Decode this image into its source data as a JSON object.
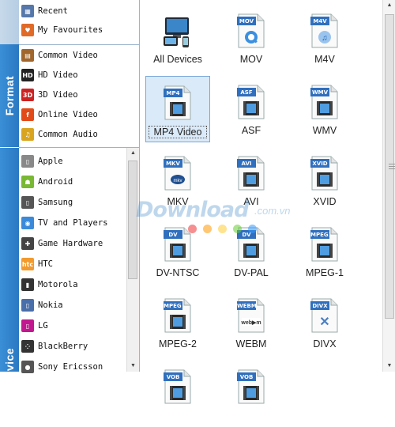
{
  "tabs": {
    "format_label": "Format",
    "device_label": "Device"
  },
  "top_list": [
    {
      "label": "Recent",
      "icon": "grid-icon",
      "color": "#5577aa"
    },
    {
      "label": "My Favourites",
      "icon": "heart-icon",
      "color": "#e06a28"
    }
  ],
  "format_list": [
    {
      "label": "Common Video",
      "icon": "film-icon",
      "color": "#a0662b"
    },
    {
      "label": "HD Video",
      "icon": "hd-icon",
      "color": "#222222"
    },
    {
      "label": "3D Video",
      "icon": "3d-icon",
      "color": "#cc2222"
    },
    {
      "label": "Online Video",
      "icon": "online-video-icon",
      "color": "#e24a1a"
    },
    {
      "label": "Common Audio",
      "icon": "music-note-icon",
      "color": "#d9a520"
    }
  ],
  "device_list": [
    {
      "label": "Apple",
      "icon": "ipod-icon",
      "color": "#888888"
    },
    {
      "label": "Android",
      "icon": "android-icon",
      "color": "#78b833"
    },
    {
      "label": "Samsung",
      "icon": "samsung-phone-icon",
      "color": "#555555"
    },
    {
      "label": "TV and Players",
      "icon": "tv-icon",
      "color": "#3b8ad9"
    },
    {
      "label": "Game Hardware",
      "icon": "gamepad-icon",
      "color": "#444444"
    },
    {
      "label": "HTC",
      "icon": "htc-icon",
      "color": "#f29a2e"
    },
    {
      "label": "Motorola",
      "icon": "motorola-phone-icon",
      "color": "#333333"
    },
    {
      "label": "Nokia",
      "icon": "nokia-phone-icon",
      "color": "#4a6ea9"
    },
    {
      "label": "LG",
      "icon": "lg-phone-icon",
      "color": "#c2188f"
    },
    {
      "label": "BlackBerry",
      "icon": "blackberry-icon",
      "color": "#333333"
    },
    {
      "label": "Sony Ericsson",
      "icon": "sony-ericsson-icon",
      "color": "#555555"
    }
  ],
  "formats": [
    {
      "label": "All Devices",
      "badge": "",
      "icon": "all-devices-icon"
    },
    {
      "label": "MOV",
      "badge": "MOV",
      "icon": "quicktime-icon"
    },
    {
      "label": "M4V",
      "badge": "M4V",
      "icon": "itunes-icon"
    },
    {
      "label": "MP4 Video",
      "badge": "MP4",
      "icon": "film-strip-icon",
      "selected": true
    },
    {
      "label": "ASF",
      "badge": "ASF",
      "icon": "film-strip-icon"
    },
    {
      "label": "WMV",
      "badge": "WMV",
      "icon": "film-strip-icon"
    },
    {
      "label": "MKV",
      "badge": "MKV",
      "icon": "mkv-icon"
    },
    {
      "label": "AVI",
      "badge": "AVI",
      "icon": "film-strip-icon"
    },
    {
      "label": "XVID",
      "badge": "XVID",
      "icon": "film-strip-icon"
    },
    {
      "label": "DV-NTSC",
      "badge": "DV",
      "icon": "film-strip-icon"
    },
    {
      "label": "DV-PAL",
      "badge": "DV",
      "icon": "film-strip-icon"
    },
    {
      "label": "MPEG-1",
      "badge": "MPEG1",
      "icon": "film-strip-icon"
    },
    {
      "label": "MPEG-2",
      "badge": "MPEG 2",
      "icon": "film-strip-icon"
    },
    {
      "label": "WEBM",
      "badge": "WEBM",
      "icon": "webm-icon"
    },
    {
      "label": "DIVX",
      "badge": "DIVX",
      "icon": "divx-icon"
    },
    {
      "label": "",
      "badge": "VOB",
      "icon": "film-strip-icon"
    },
    {
      "label": "",
      "badge": "VOB",
      "icon": "film-strip-icon"
    }
  ],
  "watermark": {
    "brand": "Download",
    "domain": ".com.vn"
  },
  "colors": {
    "accent": "#2a78c2",
    "badge": "#2f6fbe",
    "selection": "#dbeaf8"
  }
}
